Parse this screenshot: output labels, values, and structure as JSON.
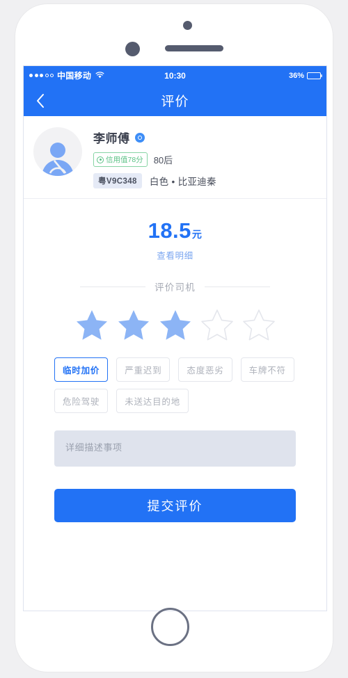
{
  "status_bar": {
    "signal_dots_filled": 3,
    "signal_dots_total": 5,
    "carrier": "中国移动",
    "time": "10:30",
    "battery_percent": "36%",
    "battery_level": 36
  },
  "nav": {
    "back_icon": "chevron-left-icon",
    "title": "评价"
  },
  "driver": {
    "avatar_icon": "user-avatar-icon",
    "name": "李师傅",
    "gender_badge_icon": "gender-badge-icon",
    "credit_badge": {
      "icon": "shield-icon",
      "text": "信用值78分"
    },
    "age_tag": "80后",
    "plate": "粤V9C348",
    "car_desc": "白色 • 比亚迪秦"
  },
  "price": {
    "amount": "18.5",
    "unit": "元",
    "detail_link": "查看明细"
  },
  "rating_section": {
    "title": "评价司机",
    "stars_total": 5,
    "stars_filled": 3,
    "star_filled_color": "#8cb4f5",
    "star_empty_color": "#e4e6ec"
  },
  "tags": [
    {
      "label": "临时加价",
      "selected": true
    },
    {
      "label": "严重迟到",
      "selected": false
    },
    {
      "label": "态度恶劣",
      "selected": false
    },
    {
      "label": "车牌不符",
      "selected": false
    },
    {
      "label": "危险驾驶",
      "selected": false
    },
    {
      "label": "未送达目的地",
      "selected": false
    }
  ],
  "description": {
    "placeholder": "详细描述事项",
    "value": ""
  },
  "submit": {
    "label": "提交评价"
  },
  "colors": {
    "primary": "#2272f5",
    "star_filled": "#8cb4f5",
    "credit_green": "#5cc286",
    "textarea_bg": "#dfe3ed"
  }
}
